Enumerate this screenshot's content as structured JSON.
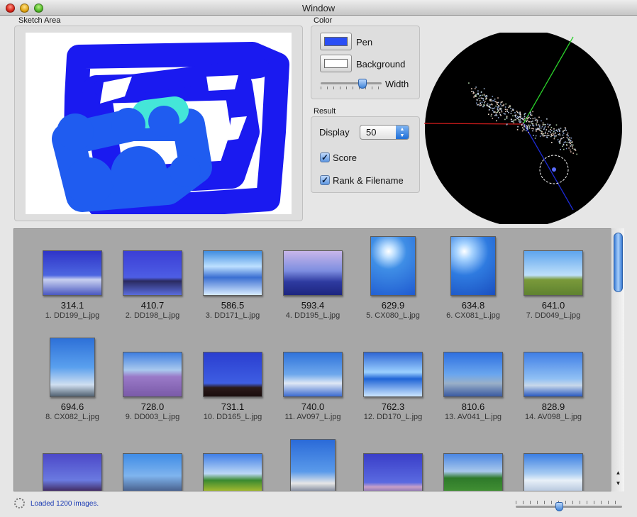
{
  "window": {
    "title": "Window"
  },
  "sketch": {
    "label": "Sketch Area"
  },
  "color": {
    "label": "Color",
    "pen_label": "Pen",
    "pen_color": "#2a4ef5",
    "background_label": "Background",
    "background_color": "#ffffff",
    "width_label": "Width",
    "width_level": 0.72
  },
  "result": {
    "label": "Result",
    "display_label": "Display",
    "display_value": "50",
    "score_label": "Score",
    "score_checked": true,
    "rank_label": "Rank & Filename",
    "rank_checked": true
  },
  "results": [
    {
      "score": "314.1",
      "name": "1. DD199_L.jpg"
    },
    {
      "score": "410.7",
      "name": "2. DD198_L.jpg"
    },
    {
      "score": "586.5",
      "name": "3. DD171_L.jpg"
    },
    {
      "score": "593.4",
      "name": "4. DD195_L.jpg"
    },
    {
      "score": "629.9",
      "name": "5. CX080_L.jpg"
    },
    {
      "score": "634.8",
      "name": "6. CX081_L.jpg"
    },
    {
      "score": "641.0",
      "name": "7. DD049_L.jpg"
    },
    {
      "score": "694.6",
      "name": "8. CX082_L.jpg"
    },
    {
      "score": "728.0",
      "name": "9. DD003_L.jpg"
    },
    {
      "score": "731.1",
      "name": "10. DD165_L.jpg"
    },
    {
      "score": "740.0",
      "name": "11. AV097_L.jpg"
    },
    {
      "score": "762.3",
      "name": "12. DD170_L.jpg"
    },
    {
      "score": "810.6",
      "name": "13. AV041_L.jpg"
    },
    {
      "score": "828.9",
      "name": "14. AV098_L.jpg"
    }
  ],
  "status": {
    "text": "Loaded 1200 images."
  },
  "thumb_size_level": 0.4
}
